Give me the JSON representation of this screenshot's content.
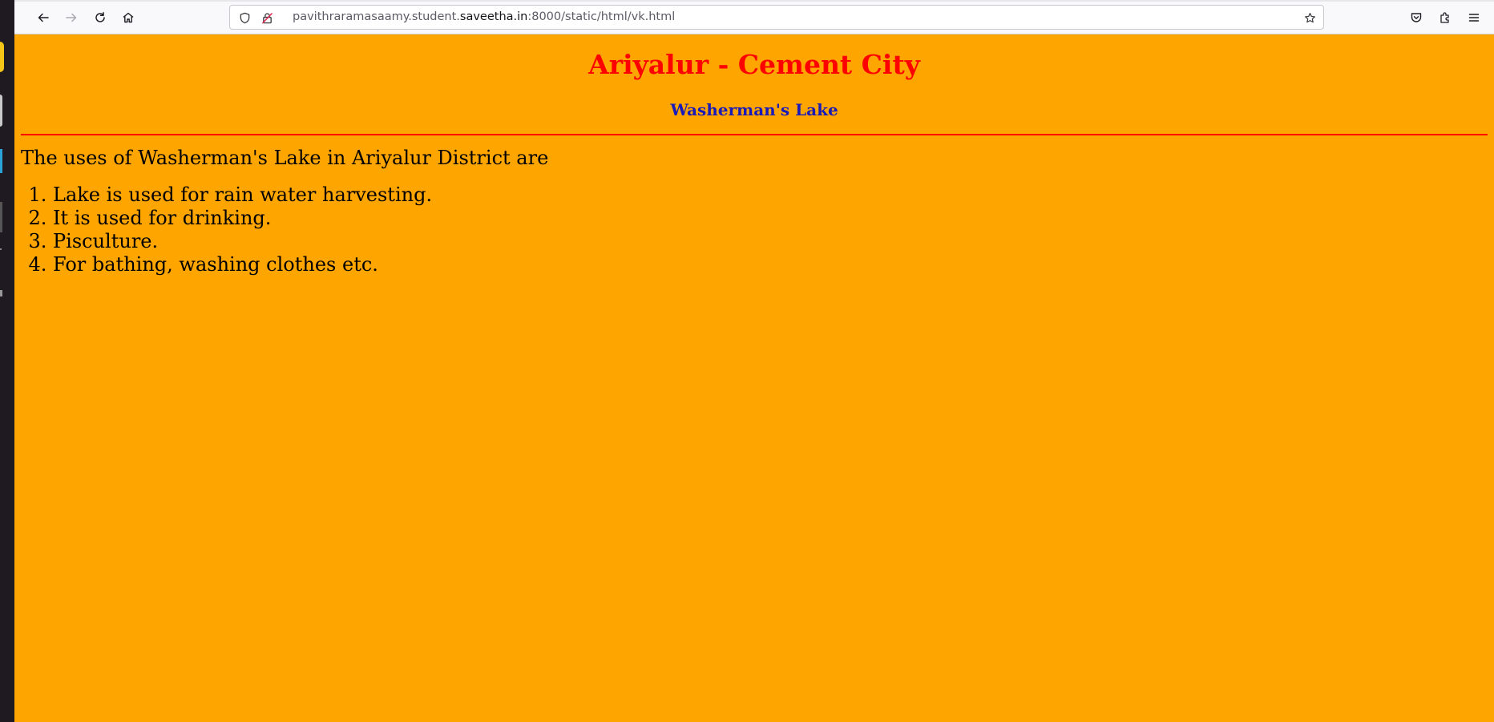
{
  "browser": {
    "url_prefix": "pavithraramasaamy.student.",
    "url_host": "saveetha.in",
    "url_suffix": ":8000/static/html/vk.html"
  },
  "page": {
    "title": "Ariyalur - Cement City",
    "subtitle": "Washerman's Lake",
    "intro": "The uses of Washerman's Lake in Ariyalur District are",
    "uses": [
      "Lake is used for rain water harvesting.",
      "It is used for drinking.",
      "Pisculture.",
      "For bathing, washing clothes etc."
    ]
  },
  "colors": {
    "background": "#ffa500",
    "title": "#ff0000",
    "subtitle": "#1a1ab8",
    "rule": "#ff0000"
  }
}
